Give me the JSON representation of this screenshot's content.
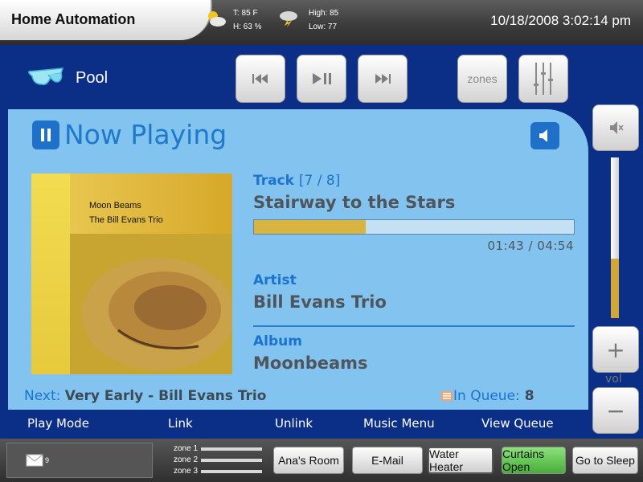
{
  "header": {
    "app_title": "Home Automation",
    "weather_now": {
      "temp": "T:  85 F",
      "humidity": "H: 63 %",
      "icon": "sun-cloud-icon"
    },
    "weather_forecast": {
      "high": "High: 85",
      "low": "Low: 77",
      "icon": "storm-cloud-icon"
    },
    "datetime": "10/18/2008 3:02:14 pm"
  },
  "zone": {
    "name": "Pool",
    "icon": "sunglasses-icon",
    "transport": [
      "previous-icon",
      "play-pause-icon",
      "next-icon"
    ],
    "zones_label": "zones",
    "equalizer_icon": "equalizer-icon"
  },
  "now_playing": {
    "title": "Now Playing",
    "track_label": "Track",
    "track_number": "[7 / 8]",
    "track": "Stairway to the Stars",
    "progress": 0.35,
    "time": "01:43 / 04:54",
    "artist_label": "Artist",
    "artist": "Bill Evans Trio",
    "album_label": "Album",
    "album": "Moonbeams",
    "album_art": {
      "title": "Moon Beams",
      "artist": "The Bill Evans Trio"
    },
    "next_label": "Next:",
    "next_value": "Very Early - Bill Evans Trio",
    "queue_label": "In Queue:",
    "queue_count": "8"
  },
  "menu": [
    "Play Mode",
    "Link",
    "Unlink",
    "Music Menu",
    "View Queue"
  ],
  "volume": {
    "level": 0.37,
    "label": "vol",
    "plus": "+",
    "minus": "−"
  },
  "footer": {
    "mail_count": "9",
    "zones": [
      "zone 1",
      "zone 2",
      "zone 3"
    ],
    "buttons": [
      "Ana's Room",
      "E-Mail",
      "Water Heater",
      "Curtains Open",
      "Go to Sleep"
    ],
    "active_button": "Curtains Open"
  },
  "colors": {
    "accent": "#1e78cc",
    "background": "#0b2f86",
    "panel": "#82c4ef",
    "gold": "#d8b441",
    "active": "#5cc04a"
  }
}
